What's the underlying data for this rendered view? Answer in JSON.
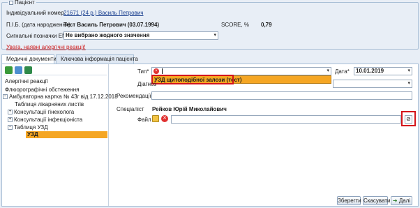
{
  "patient": {
    "legend": "Пацієнт",
    "id_label": "Індивідуальний номер",
    "id_value": "21671 (24 р.) Василь Петрович",
    "name_label": "П.І.Б. (дата народження)",
    "name_value": "Тест Василь Петрович (03.07.1994)",
    "score_label": "SCORE, %",
    "score_value": "0,79",
    "signal_label": "Сигнальні позначки ЕМК",
    "signal_value": "Не вибрано жодного значення",
    "allergy_warning": "Увага, наявні алергічні реакції!"
  },
  "tabs": [
    {
      "label": "Медичні документи"
    },
    {
      "label": "Ключова інформація пацієнта"
    }
  ],
  "tree": {
    "items": [
      {
        "label": "Алергічні реакції"
      },
      {
        "label": "Флюорографічні обстеження"
      },
      {
        "label": "Амбулаторна картка № 43г від 17.12.2018"
      },
      {
        "label": "Таблиця лікарняних листів"
      },
      {
        "label": "Консультації гінеколога"
      },
      {
        "label": "Консультації інфекціоніста"
      },
      {
        "label": "Таблиця УЗД"
      },
      {
        "label": "УЗД"
      }
    ]
  },
  "form": {
    "type_label": "Тип*",
    "type_option": "УЗД щитоподібної залози (тест)",
    "date_label": "Дата*",
    "date_value": "10.01.2019",
    "diagnosis_label": "Діагноз",
    "recommendations_label": "Рекомендації",
    "specialist_label": "Спеціаліст",
    "specialist_value": "Рейков Юрій Миколайович",
    "file_label": "Файл"
  },
  "buttons": {
    "save": "Зберегти",
    "cancel": "Скасувати",
    "next": "Далі"
  },
  "colors": {
    "accent_orange": "#f5a623",
    "highlight_red": "#d4141b",
    "link_blue": "#1a3f8f",
    "warning_red": "#d11b1b"
  }
}
